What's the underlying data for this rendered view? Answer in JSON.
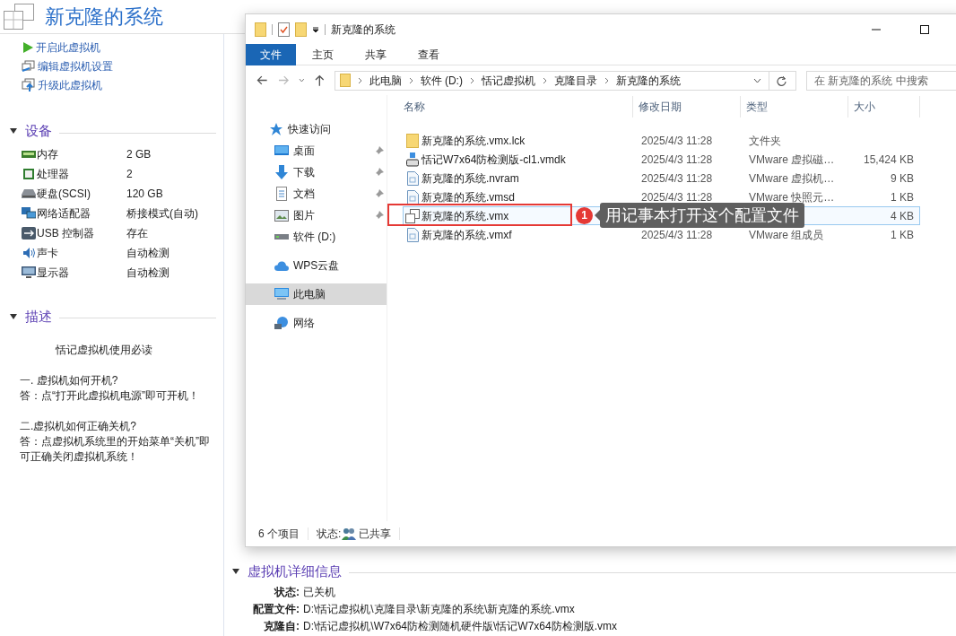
{
  "vm": {
    "title": "新克隆的系统",
    "actions": [
      {
        "kind": "play",
        "label": "开启此虚拟机"
      },
      {
        "kind": "edit",
        "label": "编辑虚拟机设置"
      },
      {
        "kind": "upgrade",
        "label": "升级此虚拟机"
      }
    ],
    "devices_header": {
      "label": "设备",
      "expanded": true
    },
    "devices": [
      {
        "kind": "memory",
        "name": "内存",
        "value": "2 GB"
      },
      {
        "kind": "cpu",
        "name": "处理器",
        "value": "2"
      },
      {
        "kind": "disk",
        "name": "硬盘(SCSI)",
        "value": "120 GB"
      },
      {
        "kind": "network",
        "name": "网络适配器",
        "value": "桥接模式(自动)"
      },
      {
        "kind": "usb",
        "name": "USB 控制器",
        "value": "存在"
      },
      {
        "kind": "sound",
        "name": "声卡",
        "value": "自动检测"
      },
      {
        "kind": "display",
        "name": "显示器",
        "value": "自动检测"
      }
    ],
    "description_header": {
      "label": "描述",
      "expanded": true
    },
    "description": {
      "title": "恬记虚拟机使用必读",
      "paragraphs": [
        [
          "一. 虚拟机如何开机?",
          "答：点“打开此虚拟机电源”即可开机！"
        ],
        [
          "二.虚拟机如何正确关机?",
          "答：点虚拟机系统里的开始菜单“关机”即可正确关闭虚拟机系统！"
        ]
      ]
    },
    "details_header": {
      "label": "虚拟机详细信息",
      "expanded": true
    },
    "details": [
      {
        "label": "状态:",
        "value": "已关机"
      },
      {
        "label": "配置文件:",
        "value": "D:\\恬记虚拟机\\克隆目录\\新克隆的系统\\新克隆的系统.vmx"
      },
      {
        "label": "克隆自:",
        "value": "D:\\恬记虚拟机\\W7x64防检测随机硬件版\\恬记W7x64防检测版.vmx"
      }
    ]
  },
  "explorer": {
    "title": "新克隆的系统",
    "ribbon_tabs": [
      {
        "label": "文件",
        "selected": true
      },
      {
        "label": "主页",
        "selected": false
      },
      {
        "label": "共享",
        "selected": false
      },
      {
        "label": "查看",
        "selected": false
      }
    ],
    "breadcrumb": [
      "此电脑",
      "软件 (D:)",
      "恬记虚拟机",
      "克隆目录",
      "新克隆的系统"
    ],
    "search": {
      "placeholder": "在 新克隆的系统 中搜索"
    },
    "nav": [
      {
        "kind": "star",
        "label": "快速访问",
        "pinned": false,
        "selected": false
      },
      {
        "kind": "desktop",
        "label": "桌面",
        "pinned": true,
        "selected": false
      },
      {
        "kind": "download",
        "label": "下载",
        "pinned": true,
        "selected": false
      },
      {
        "kind": "document",
        "label": "文档",
        "pinned": true,
        "selected": false
      },
      {
        "kind": "picture",
        "label": "图片",
        "pinned": true,
        "selected": false
      },
      {
        "kind": "drive",
        "label": "软件 (D:)",
        "pinned": false,
        "selected": false
      },
      {
        "kind": "cloud",
        "label": "WPS云盘",
        "pinned": false,
        "selected": false
      },
      {
        "kind": "pc",
        "label": "此电脑",
        "pinned": false,
        "selected": true
      },
      {
        "kind": "network",
        "label": "网络",
        "pinned": false,
        "selected": false
      }
    ],
    "columns": [
      "名称",
      "修改日期",
      "类型",
      "大小"
    ],
    "files": [
      {
        "kind": "folder",
        "name": "新克隆的系统.vmx.lck",
        "date": "2025/4/3 11:28",
        "type": "文件夹",
        "selected": false
      },
      {
        "kind": "disk",
        "name": "恬记W7x64防检测版-cl1.vmdk",
        "date": "2025/4/3 11:28",
        "type": "VMware 虚拟磁…",
        "size": "15,424 KB",
        "selected": false
      },
      {
        "kind": "file",
        "name": "新克隆的系统.nvram",
        "date": "2025/4/3 11:28",
        "type": "VMware 虚拟机…",
        "size": "9 KB",
        "selected": false
      },
      {
        "kind": "file",
        "name": "新克隆的系统.vmsd",
        "date": "2025/4/3 11:28",
        "type": "VMware 快照元…",
        "size": "1 KB",
        "selected": false
      },
      {
        "kind": "vm",
        "name": "新克隆的系统.vmx",
        "size": "4 KB",
        "selected": true
      },
      {
        "kind": "file",
        "name": "新克隆的系统.vmxf",
        "date": "2025/4/3 11:28",
        "type": "VMware 组成员",
        "size": "1 KB",
        "selected": false
      }
    ],
    "status": {
      "count": "6 个项目",
      "state_label": "状态:",
      "state": "已共享"
    }
  },
  "annotation": {
    "number": "1",
    "text": "用记事本打开这个配置文件"
  }
}
